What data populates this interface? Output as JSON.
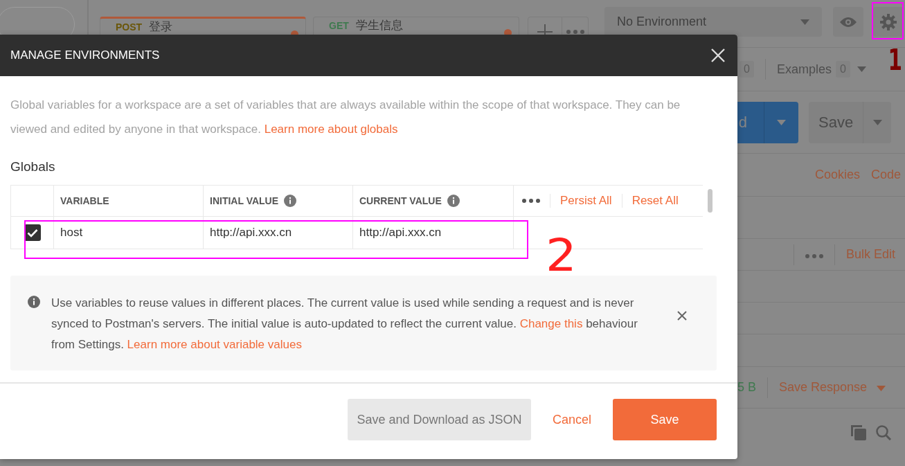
{
  "app": {
    "tabs": [
      {
        "method": "POST",
        "color": "#6a5608",
        "title": "登录",
        "selected": true
      },
      {
        "method": "GET",
        "color": "#3f7a4f",
        "title": "学生信息",
        "selected": false
      }
    ],
    "environment": {
      "value": "No Environment"
    },
    "tab_counts": {
      "count": "0",
      "label": "Examples",
      "examples_count": "0"
    },
    "send_button": "d",
    "save_button": "Save",
    "links": [
      "Cookies",
      "Code"
    ],
    "bulk_edit": "Bulk Edit",
    "response_size": "5 B",
    "save_response": "Save Response"
  },
  "dialog": {
    "title": "MANAGE ENVIRONMENTS",
    "description": "Global variables for a workspace are a set of variables that are always available within the scope of that workspace. They can be viewed and edited by anyone in that workspace. ",
    "description_link": "Learn more about globals",
    "section": "Globals",
    "columns": [
      {
        "label": "VARIABLE",
        "info": false
      },
      {
        "label": "INITIAL VALUE",
        "info": true
      },
      {
        "label": "CURRENT VALUE",
        "info": true
      }
    ],
    "actions": [
      "Persist All",
      "Reset All"
    ],
    "rows": [
      {
        "checked": true,
        "variable": "host",
        "initial": "http://api.xxx.cn",
        "current": "http://api.xxx.cn"
      }
    ],
    "info": {
      "text": "Use variables to reuse values in different places. The current value is used while sending a request and is never synced to Postman's servers. The initial value is auto-updated to reflect the current value. ",
      "link1": "Change this",
      "middle": " behaviour from Settings. ",
      "link2": "Learn more about variable values"
    },
    "buttons": [
      {
        "kind": "secondary",
        "label": "Save and Download as JSON"
      },
      {
        "kind": "link",
        "label": "Cancel"
      },
      {
        "kind": "primary",
        "label": "Save"
      }
    ]
  },
  "annotations": [
    "1",
    "2"
  ]
}
